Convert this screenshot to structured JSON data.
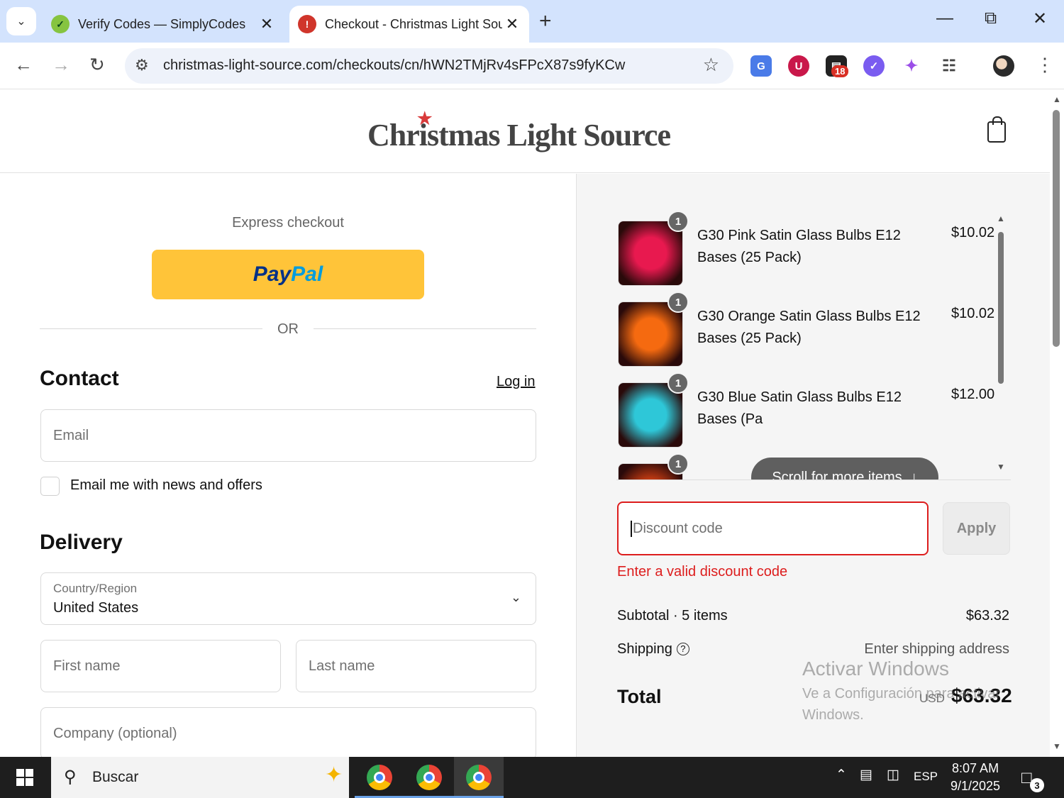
{
  "browser": {
    "tabs": [
      {
        "title": "Verify Codes — SimplyCodes",
        "favicon": "simplycodes-icon",
        "active": false
      },
      {
        "title": "Checkout - Christmas Light Sou",
        "favicon": "christmas-light-icon",
        "active": true
      }
    ],
    "url": "christmas-light-source.com/checkouts/cn/hWN2TMjRv4sFPcX87s9fyKCw",
    "extension_badge": "18"
  },
  "site": {
    "logo_text": "Christmas Light Source"
  },
  "checkout": {
    "express_label": "Express checkout",
    "paypal_a": "Pay",
    "paypal_b": "Pal",
    "or_label": "OR",
    "contact_heading": "Contact",
    "login_link": "Log in",
    "email_placeholder": "Email",
    "newsletter_label": "Email me with news and offers",
    "delivery_heading": "Delivery",
    "country_label": "Country/Region",
    "country_value": "United States",
    "first_name_placeholder": "First name",
    "last_name_placeholder": "Last name",
    "company_placeholder": "Company (optional)"
  },
  "order": {
    "items": [
      {
        "name": "G30 Pink Satin Glass Bulbs E12 Bases (25 Pack)",
        "price": "$10.02",
        "qty": "1",
        "color": "#e8194f"
      },
      {
        "name": "G30 Orange Satin Glass Bulbs E12 Bases (25 Pack)",
        "price": "$10.02",
        "qty": "1",
        "color": "#f56a10"
      },
      {
        "name": "G30 Blue Satin Glass Bulbs E12 Bases (Pa",
        "price": "$12.00",
        "qty": "1",
        "color": "#2ec7d8"
      },
      {
        "name": "",
        "price": "",
        "qty": "1",
        "color": "#c53b12"
      }
    ],
    "scroll_hint": "Scroll for more items",
    "discount_placeholder": "Discount code",
    "apply_label": "Apply",
    "discount_error": "Enter a valid discount code",
    "subtotal_label": "Subtotal · 5 items",
    "subtotal_value": "$63.32",
    "shipping_label": "Shipping",
    "shipping_value": "Enter shipping address",
    "total_label": "Total",
    "total_currency": "USD",
    "total_value": "$63.32"
  },
  "watermark": {
    "line1": "Activar Windows",
    "line2": "Ve a Configuración para activar",
    "line3": "Windows."
  },
  "taskbar": {
    "search_text": "Buscar",
    "language": "ESP",
    "time": "8:07 AM",
    "date": "9/1/2025",
    "notification_count": "3"
  }
}
